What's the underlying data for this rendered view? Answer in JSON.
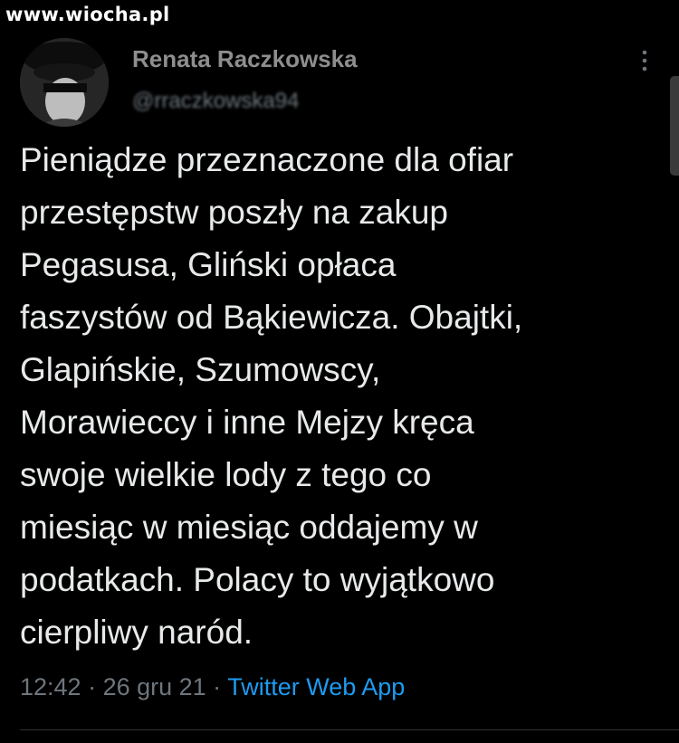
{
  "watermark": "www.wiocha.pl",
  "tweet": {
    "author_name": "Renata Raczkowska",
    "author_handle": "@rraczkowska94",
    "text": "Pieniądze przeznaczone dla ofiar\nprzestępstw poszły na zakup\nPegasusa, Gliński opłaca\nfaszystów od Bąkiewicza. Obajtki,\nGlapińskie, Szumowscy,\nMorawieccy i inne Mejzy kręca\nswoje wielkie lody z tego co\nmiesiąc w miesiąc oddajemy w\npodatkach. Polacy to wyjątkowo\ncierpliwy naród.",
    "time": "12:42",
    "separator": " · ",
    "date": "26 gru 21",
    "source": "Twitter Web App"
  },
  "icons": {
    "more": "more-options-icon",
    "avatar": "avatar"
  },
  "colors": {
    "background": "#000000",
    "text": "#e7e9ea",
    "muted": "#6e767d",
    "link": "#1d9bf0"
  }
}
